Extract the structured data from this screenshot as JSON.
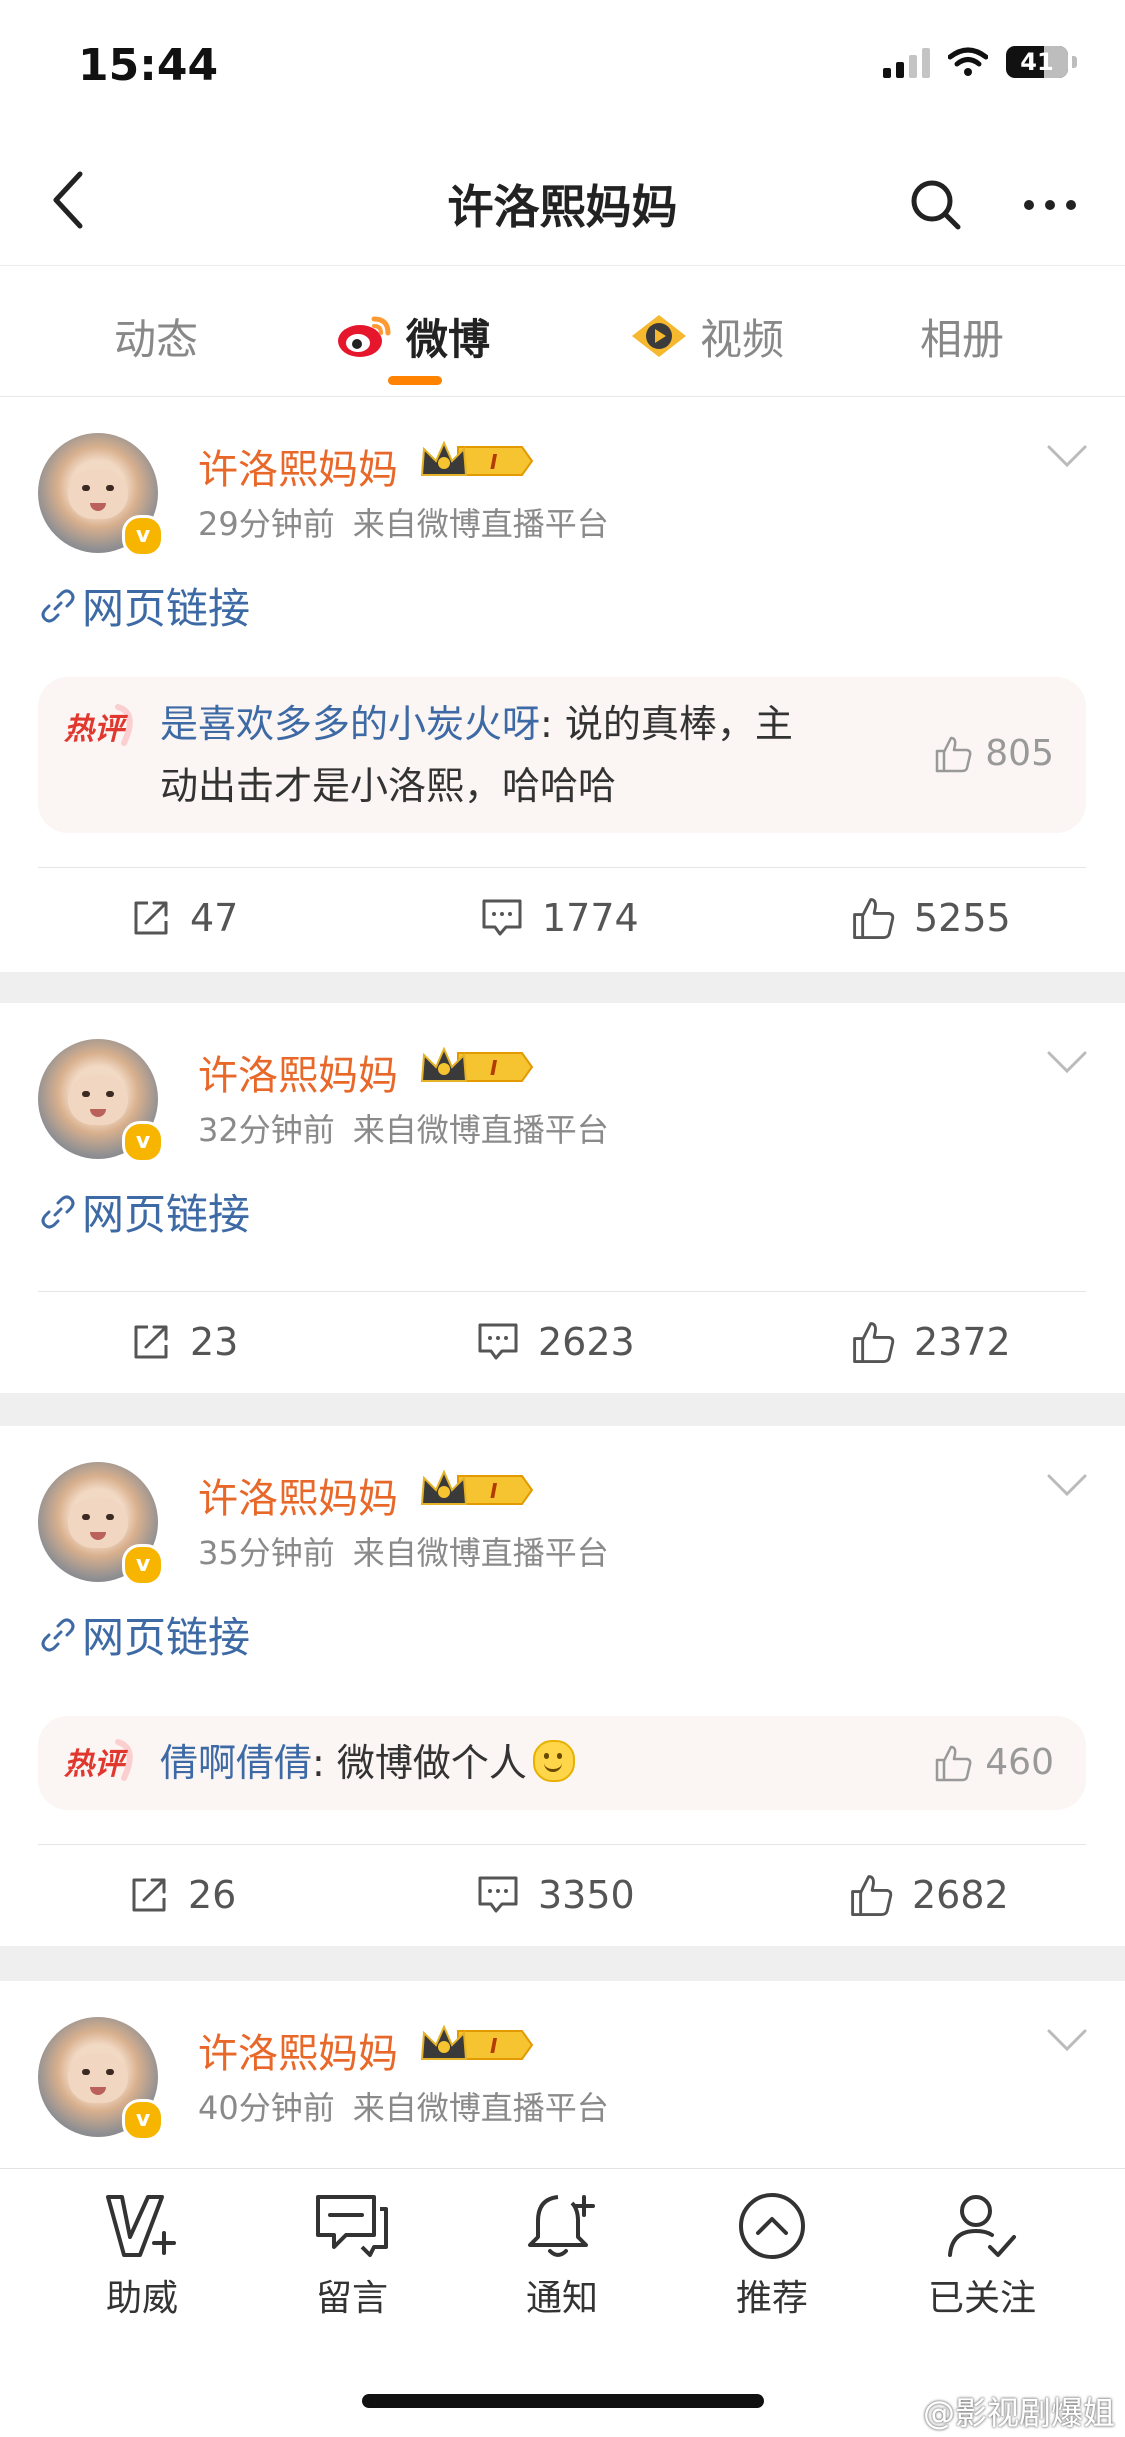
{
  "status_bar": {
    "time": "15:44",
    "battery": "41"
  },
  "header": {
    "title": "许洛熙妈妈"
  },
  "tabs": [
    {
      "label": "动态",
      "active": false
    },
    {
      "label": "微博",
      "active": true
    },
    {
      "label": "视频",
      "active": false
    },
    {
      "label": "相册",
      "active": false
    }
  ],
  "posts": [
    {
      "user": "许洛熙妈妈",
      "verified": "v",
      "member_level": "I",
      "time": "29分钟前",
      "source": "来自微博直播平台",
      "link": "网页链接",
      "hot_comment": {
        "tag": "热评",
        "user": "是喜欢多多的小炭火呀",
        "text_line1": ": 说的真棒，主",
        "text_line2": "动出击才是小洛熙，哈哈哈",
        "likes": "805"
      },
      "reposts": "47",
      "comments": "1774",
      "likes": "5255"
    },
    {
      "user": "许洛熙妈妈",
      "verified": "v",
      "member_level": "I",
      "time": "32分钟前",
      "source": "来自微博直播平台",
      "link": "网页链接",
      "reposts": "23",
      "comments": "2623",
      "likes": "2372"
    },
    {
      "user": "许洛熙妈妈",
      "verified": "v",
      "member_level": "I",
      "time": "35分钟前",
      "source": "来自微博直播平台",
      "link": "网页链接",
      "hot_comment": {
        "tag": "热评",
        "user": "倩啊倩倩",
        "text_line1": ": 微博做个人",
        "likes": "460"
      },
      "reposts": "26",
      "comments": "3350",
      "likes": "2682"
    },
    {
      "user": "许洛熙妈妈",
      "verified": "v",
      "member_level": "I",
      "time": "40分钟前",
      "source": "来自微博直播平台"
    }
  ],
  "bottom_nav": [
    {
      "label": "助威",
      "icon": "support-icon"
    },
    {
      "label": "留言",
      "icon": "message-icon"
    },
    {
      "label": "通知",
      "icon": "bell-icon"
    },
    {
      "label": "推荐",
      "icon": "recommend-icon"
    },
    {
      "label": "已关注",
      "icon": "followed-icon"
    }
  ],
  "watermark": "@影视剧爆姐",
  "colors": {
    "accent": "#ff8200",
    "username": "#e8682a",
    "link": "#3d6aa5"
  }
}
